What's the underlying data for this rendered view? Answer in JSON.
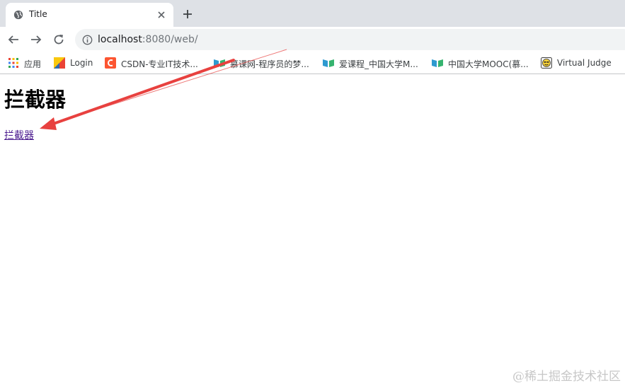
{
  "tab": {
    "title": "Title"
  },
  "toolbar": {
    "url_host": "localhost",
    "url_rest": ":8080/web/"
  },
  "bookmarks": [
    {
      "label": "应用",
      "icon": "apps-grid-icon"
    },
    {
      "label": "Login",
      "icon": "login-favicon"
    },
    {
      "label": "CSDN-专业IT技术...",
      "icon": "csdn-favicon"
    },
    {
      "label": "慕课网-程序员的梦...",
      "icon": "book-favicon"
    },
    {
      "label": "爱课程_中国大学M...",
      "icon": "book-favicon"
    },
    {
      "label": "中国大学MOOC(慕...",
      "icon": "book-favicon"
    },
    {
      "label": "Virtual Judge",
      "icon": "virtual-judge-favicon"
    }
  ],
  "page": {
    "heading": "拦截器",
    "link_text": "拦截器"
  },
  "watermark": "@稀土掘金技术社区",
  "colors": {
    "arrow": "#e8413f",
    "visited_link": "#4a1a8e",
    "tabstrip": "#dee1e6"
  }
}
